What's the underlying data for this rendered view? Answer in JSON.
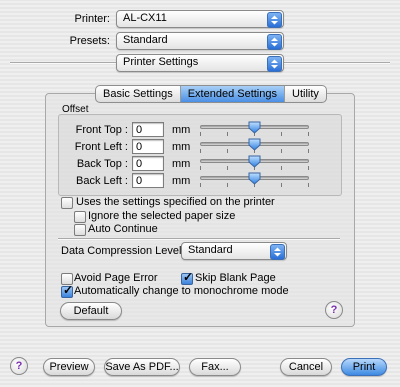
{
  "printer": {
    "label": "Printer:",
    "value": "AL-CX11"
  },
  "presets": {
    "label": "Presets:",
    "value": "Standard"
  },
  "panel_menu": {
    "value": "Printer Settings"
  },
  "tabs": [
    {
      "label": "Basic Settings",
      "active": false
    },
    {
      "label": "Extended Settings",
      "active": true
    },
    {
      "label": "Utility",
      "active": false
    }
  ],
  "offset": {
    "title": "Offset",
    "unit": "mm",
    "rows": [
      {
        "label": "Front Top :",
        "value": "0",
        "slider_fraction": 0.5
      },
      {
        "label": "Front Left :",
        "value": "0",
        "slider_fraction": 0.5
      },
      {
        "label": "Back Top :",
        "value": "0",
        "slider_fraction": 0.5
      },
      {
        "label": "Back Left :",
        "value": "0",
        "slider_fraction": 0.5
      }
    ]
  },
  "options": {
    "use_printer_settings": {
      "label": "Uses the settings specified on the printer",
      "checked": false
    },
    "ignore_paper_size": {
      "label": "Ignore the selected paper size",
      "checked": false
    },
    "auto_continue": {
      "label": "Auto Continue",
      "checked": false
    },
    "compression": {
      "label": "Data Compression Level :",
      "value": "Standard"
    },
    "avoid_page_error": {
      "label": "Avoid Page Error",
      "checked": false
    },
    "skip_blank_page": {
      "label": "Skip Blank Page",
      "checked": true
    },
    "auto_monochrome": {
      "label": "Automatically change to monochrome mode",
      "checked": true
    }
  },
  "buttons": {
    "default": "Default",
    "help": "?",
    "preview": "Preview",
    "save_pdf": "Save As PDF...",
    "fax": "Fax...",
    "cancel": "Cancel",
    "print": "Print"
  },
  "colors": {
    "accent": "#3d8ae2",
    "help_glyph": "#7a2fb0"
  },
  "icons": {
    "popup": "updown-arrows-icon",
    "check": "checkmark-icon",
    "help": "question-mark-icon"
  }
}
